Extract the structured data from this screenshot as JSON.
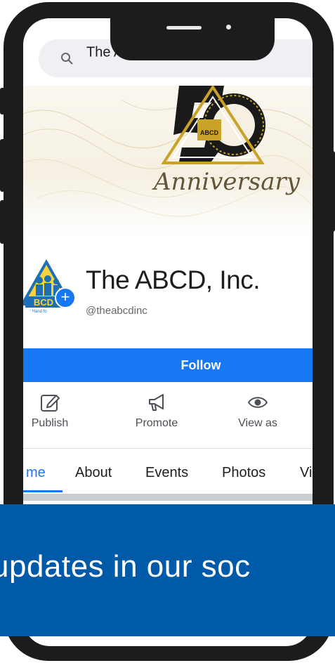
{
  "search": {
    "query": "The ABCD, Inc."
  },
  "cover": {
    "logo_number": "50",
    "logo_badge": "ABCD",
    "script_text": "Anniversary"
  },
  "profile": {
    "avatar_badge": "BCD",
    "avatar_tagline": "ng Hand fo",
    "name": "The ABCD, Inc.",
    "handle": "@theabcdinc"
  },
  "follow_label": "Follow",
  "actions": [
    {
      "label": "Publish",
      "icon": "edit-icon"
    },
    {
      "label": "Promote",
      "icon": "megaphone-icon"
    },
    {
      "label": "View as",
      "icon": "eye-icon"
    }
  ],
  "tabs": [
    {
      "label": "me",
      "active": true
    },
    {
      "label": "About"
    },
    {
      "label": "Events"
    },
    {
      "label": "Photos"
    },
    {
      "label": "Vi"
    }
  ],
  "banner": {
    "text": "updates in our soc"
  },
  "colors": {
    "accent": "#1877f2",
    "banner": "#005aa7",
    "frame": "#1c1c1c"
  }
}
